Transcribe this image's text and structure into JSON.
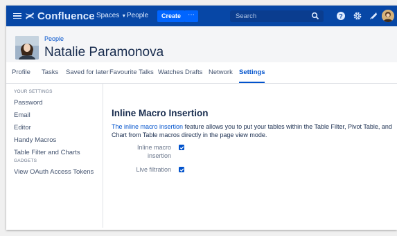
{
  "topnav": {
    "app_name": "Confluence",
    "spaces_label": "Spaces",
    "people_label": "People",
    "create_label": "Create",
    "more_label": "···",
    "search_placeholder": "Search",
    "colors": {
      "bar": "#0747a6",
      "button": "#0065ff"
    },
    "icons": [
      "menu-icon",
      "confluence-logo-icon",
      "chevron-down-icon",
      "search-icon",
      "help-icon",
      "gear-icon",
      "notification-icon",
      "user-avatar"
    ]
  },
  "profile": {
    "breadcrumb": "People",
    "name": "Natalie Paramonova"
  },
  "tabs": [
    {
      "label": "Profile"
    },
    {
      "label": "Tasks"
    },
    {
      "label": "Saved for later"
    },
    {
      "label": "Favourite Talks"
    },
    {
      "label": "Watches"
    },
    {
      "label": "Drafts"
    },
    {
      "label": "Network"
    },
    {
      "label": "Settings",
      "active": true
    }
  ],
  "sidebar": {
    "your_settings_heading": "YOUR SETTINGS",
    "items": [
      {
        "label": "Password"
      },
      {
        "label": "Email"
      },
      {
        "label": "Editor"
      },
      {
        "label": "Handy Macros"
      },
      {
        "label": "Table Filter and Charts"
      }
    ],
    "gadgets_heading": "GADGETS",
    "gadget_items": [
      {
        "label": "View OAuth Access Tokens"
      }
    ]
  },
  "main": {
    "title": "Inline Macro Insertion",
    "link_text": "The inline macro insertion",
    "description_rest": " feature allows you to put your tables within the Table Filter, Pivot Table, and Chart from Table macros directly in the page view mode.",
    "options": [
      {
        "label": "Inline macro insertion",
        "checked": true
      },
      {
        "label": "Live filtration",
        "checked": true
      }
    ],
    "accent_color": "#0052cc"
  }
}
